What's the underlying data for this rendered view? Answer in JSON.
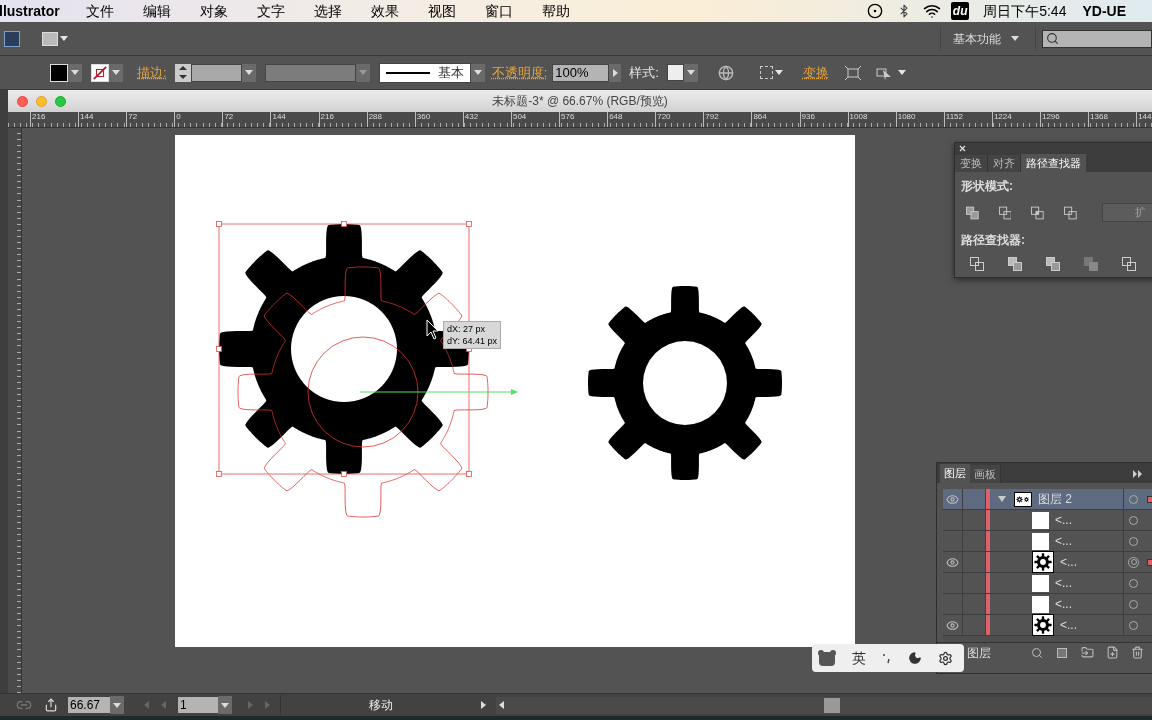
{
  "menu_bar": {
    "app_name": "llustrator",
    "menus": [
      "文件",
      "编辑",
      "对象",
      "文字",
      "选择",
      "效果",
      "视图",
      "窗口",
      "帮助"
    ],
    "input_method_badge": "du",
    "clock": "周日下午5:44",
    "user": "YD-UE"
  },
  "app_bar": {
    "workspace": "基本功能"
  },
  "control_bar": {
    "stroke_label": "描边:",
    "stroke_profile": "基本",
    "opacity_label": "不透明度:",
    "opacity": "100%",
    "style_label": "样式:",
    "transform_label": "变换"
  },
  "document": {
    "title": "未标题-3* @ 66.67% (RGB/预览)",
    "ruler_labels": [
      "216",
      "144",
      "72",
      "0",
      "72",
      "144",
      "216",
      "288",
      "360",
      "432",
      "504",
      "576",
      "648",
      "720",
      "792",
      "864",
      "936",
      "1008",
      "1080",
      "1152",
      "1224",
      "1296",
      "1368",
      "144"
    ]
  },
  "move_tooltip": {
    "lines": [
      "dX: 27 px",
      "dY: 64.41 px"
    ]
  },
  "pathfinder_panel": {
    "tabs": [
      {
        "label": "变换",
        "selected": false
      },
      {
        "label": "对齐",
        "selected": false
      },
      {
        "label": "路径查找器",
        "selected": true
      }
    ],
    "shape_modes_label": "形状模式:",
    "expand_button": {
      "label": "扩",
      "disabled": true
    },
    "pathfinders_label": "路径查找器:"
  },
  "layers_panel": {
    "tabs": [
      {
        "label": "图层",
        "selected": true
      },
      {
        "label": "画板",
        "selected": false
      }
    ],
    "layers": [
      {
        "name": "图层 2",
        "color": "#e0606a",
        "visible": true,
        "expanded": true,
        "selected": true,
        "targeted": false,
        "has_selection": true,
        "children": [
          {
            "name": "<...",
            "kind": "blank",
            "visible": false,
            "targeted": false,
            "has_selection": false
          },
          {
            "name": "<...",
            "kind": "blank",
            "visible": false,
            "targeted": false,
            "has_selection": false
          },
          {
            "name": "<...",
            "kind": "gear",
            "visible": true,
            "targeted": true,
            "has_selection": true
          },
          {
            "name": "<...",
            "kind": "blank",
            "visible": false,
            "targeted": false,
            "has_selection": false
          },
          {
            "name": "<...",
            "kind": "blank",
            "visible": false,
            "targeted": false,
            "has_selection": false
          },
          {
            "name": "<...",
            "kind": "gear",
            "visible": true,
            "targeted": false,
            "has_selection": false
          }
        ]
      }
    ],
    "footer": "图层"
  },
  "ime_bar": {
    "language": "英"
  },
  "status_bar": {
    "zoom": "66.67",
    "page": "1",
    "tool": "移动"
  }
}
